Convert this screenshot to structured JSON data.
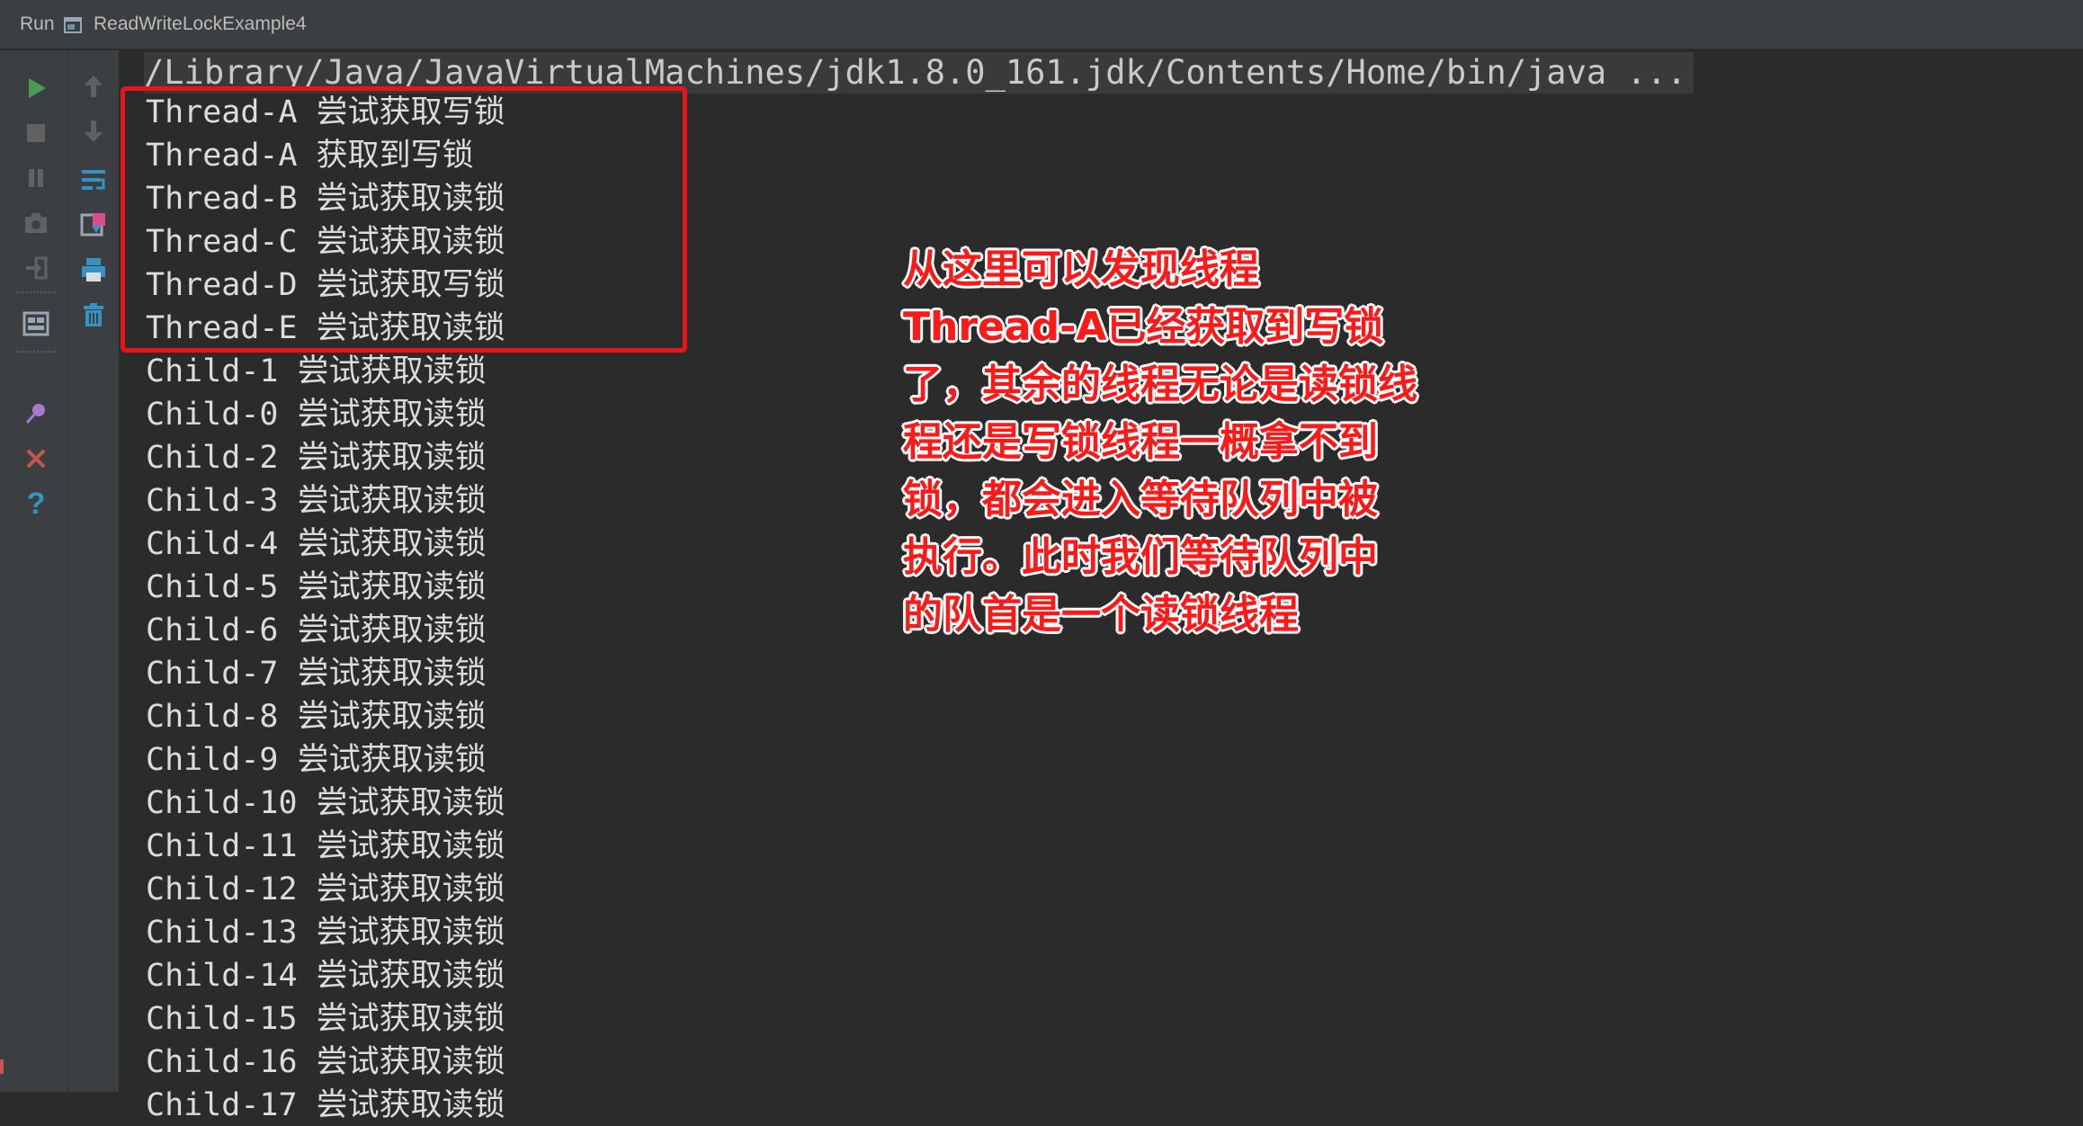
{
  "run_bar": {
    "run_label": "Run",
    "config_name": "ReadWriteLockExample4"
  },
  "toolbar": {
    "left": [
      {
        "name": "rerun-icon",
        "color": "#499c54"
      },
      {
        "name": "stop-icon",
        "color": "#6e6e6e"
      },
      {
        "name": "pause-icon",
        "color": "#6e6e6e"
      },
      {
        "name": "camera-icon",
        "color": "#6e6e6e"
      },
      {
        "name": "login-icon",
        "color": "#6e6e6e"
      },
      {
        "name": "layout-icon",
        "color": "#9aa7b0"
      },
      {
        "name": "pin-icon",
        "color": "#a57bd1"
      },
      {
        "name": "close-icon",
        "color": "#c75450"
      },
      {
        "name": "help-icon",
        "color": "#3592c4"
      }
    ],
    "right": [
      {
        "name": "up-arrow-icon",
        "color": "#6e6e6e"
      },
      {
        "name": "down-arrow-icon",
        "color": "#6e6e6e"
      },
      {
        "name": "soft-wrap-icon",
        "color": "#3592c4"
      },
      {
        "name": "scroll-to-end-icon",
        "color": "#3592c4"
      },
      {
        "name": "print-icon",
        "color": "#3592c4"
      },
      {
        "name": "trash-icon",
        "color": "#3592c4"
      }
    ]
  },
  "console": {
    "command": "/Library/Java/JavaVirtualMachines/jdk1.8.0_161.jdk/Contents/Home/bin/java ...",
    "lines": [
      "Thread-A 尝试获取写锁",
      "Thread-A 获取到写锁",
      "Thread-B 尝试获取读锁",
      "Thread-C 尝试获取读锁",
      "Thread-D 尝试获取写锁",
      "Thread-E 尝试获取读锁",
      "Child-1 尝试获取读锁",
      "Child-0 尝试获取读锁",
      "Child-2 尝试获取读锁",
      "Child-3 尝试获取读锁",
      "Child-4 尝试获取读锁",
      "Child-5 尝试获取读锁",
      "Child-6 尝试获取读锁",
      "Child-7 尝试获取读锁",
      "Child-8 尝试获取读锁",
      "Child-9 尝试获取读锁",
      "Child-10 尝试获取读锁",
      "Child-11 尝试获取读锁",
      "Child-12 尝试获取读锁",
      "Child-13 尝试获取读锁",
      "Child-14 尝试获取读锁",
      "Child-15 尝试获取读锁",
      "Child-16 尝试获取读锁",
      "Child-17 尝试获取读锁"
    ]
  },
  "annotation": {
    "color": "#ff1a1a",
    "lines": [
      "从这里可以发现线程",
      "Thread-A已经获取到写锁",
      "了，其余的线程无论是读锁线",
      "程还是写锁线程一概拿不到",
      "锁，都会进入等待队列中被",
      "执行。此时我们等待队列中",
      "的队首是一个读锁线程"
    ]
  },
  "colors": {
    "background": "#2b2b2b",
    "toolbar": "#3c3f41",
    "text": "#dcdcdc",
    "highlight_border": "#e8141c"
  }
}
